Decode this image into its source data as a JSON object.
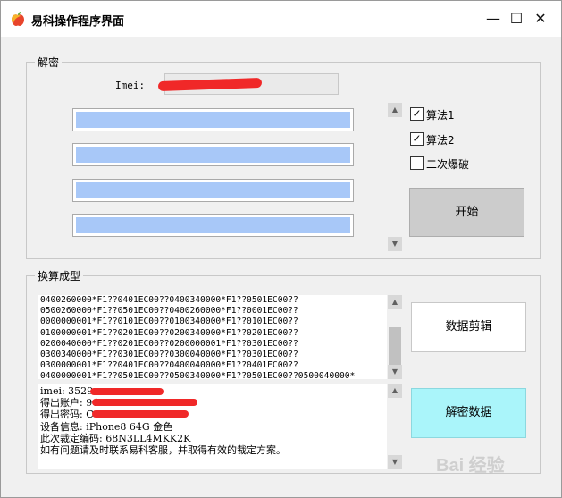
{
  "window": {
    "title": "易科操作程序界面",
    "app_icon": "apple-icon",
    "controls": {
      "minimize": "—",
      "maximize": "☐",
      "close": "✕"
    }
  },
  "decrypt_group": {
    "title": "解密",
    "imei_label": "Imei:",
    "checkboxes": [
      {
        "label": "算法1",
        "checked": true
      },
      {
        "label": "算法2",
        "checked": true
      },
      {
        "label": "二次爆破",
        "checked": false
      }
    ],
    "start_button": "开始"
  },
  "convert_group": {
    "title": "换算成型",
    "code_lines": [
      "0400260000*F1??0401EC00??0400340000*F1??0501EC00??",
      "0500260000*F1??0501EC00??0400260000*F1??0001EC00??",
      "0000000001*F1??0101EC00??0100340000*F1??0101EC00??",
      "0100000001*F1??0201EC00??0200340000*F1??0201EC00??",
      "0200040000*F1??0201EC00??0200000001*F1??0301EC00??",
      "0300340000*F1??0301EC00??0300040000*F1??0301EC00??",
      "0300000001*F1??0401EC00??0400040000*F1??0401EC00??",
      "0400000001*F1??0501EC00??0500340000*F1??0501EC00??0500040000*"
    ],
    "info_lines": [
      "imei: 3529",
      "得出账户: 94",
      "得出密码: C",
      "设备信息: iPhone8 64G 金色",
      "此次裁定编码: 68N3LL4MKK2K",
      "如有问题请及时联系易科客服，并取得有效的裁定方案。"
    ],
    "edit_button": "数据剪辑",
    "decrypt_button": "解密数据"
  },
  "watermark": "Bai 经验",
  "colors": {
    "selection": "#a8c8f8",
    "decrypt_button_bg": "#aaf5fa",
    "start_button_bg": "#cccccc",
    "redaction": "#f02828"
  }
}
